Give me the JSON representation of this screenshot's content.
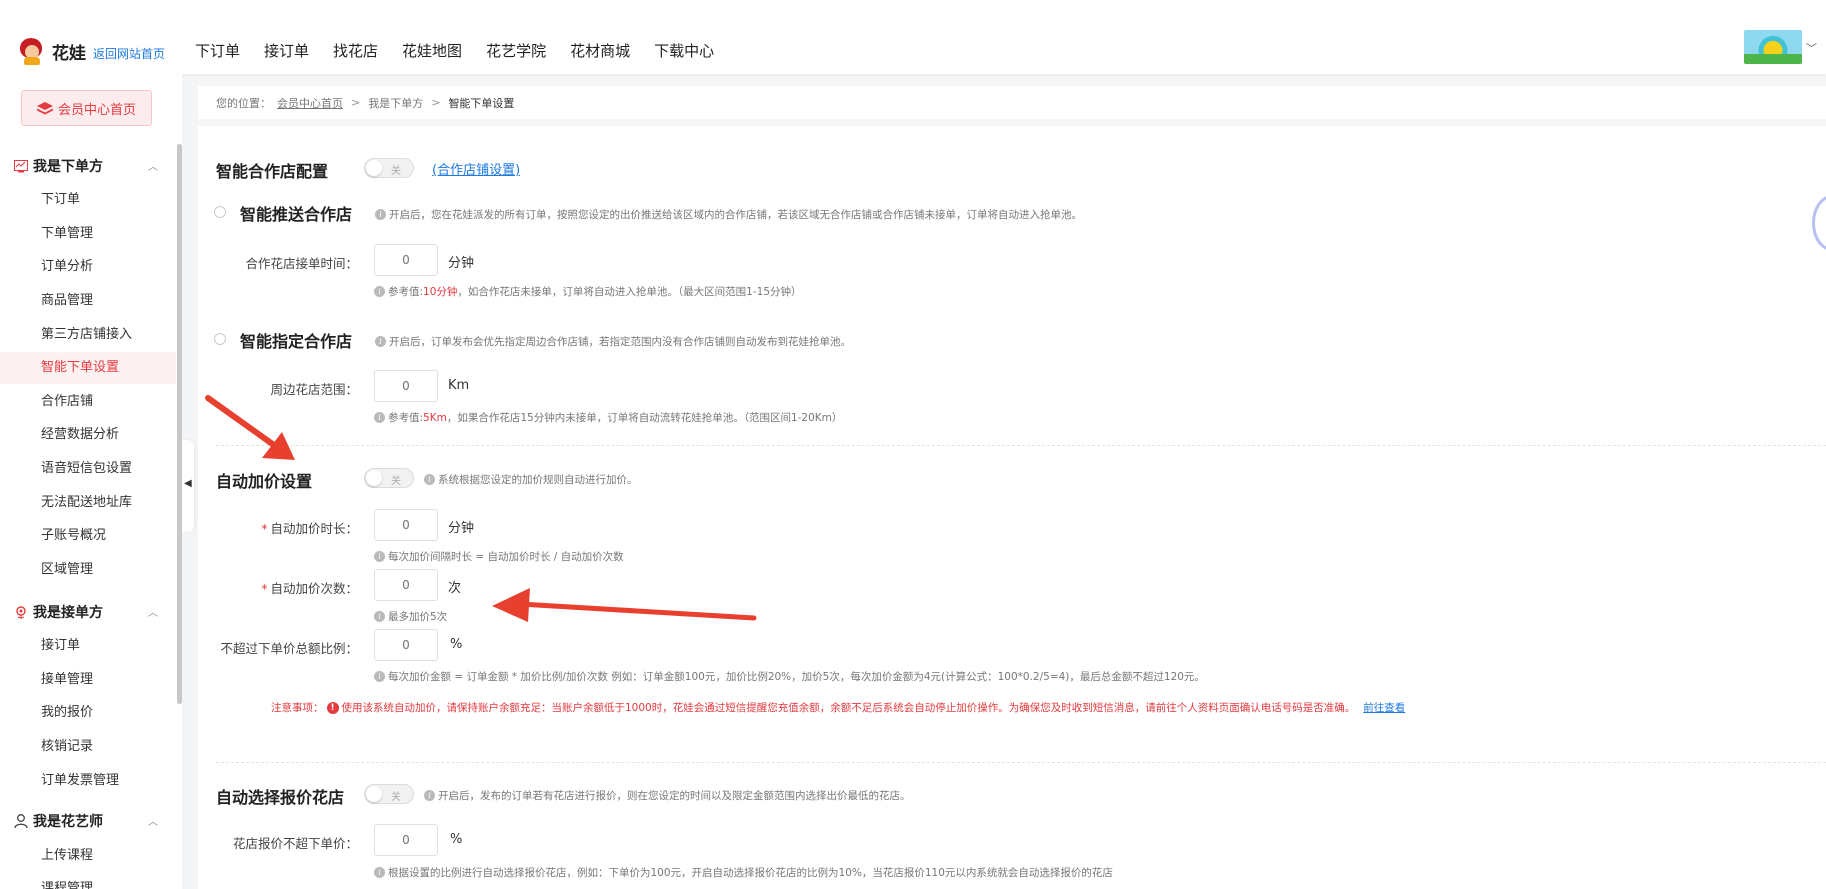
{
  "header": {
    "logo_text": "花娃",
    "back_home": "返回网站首页",
    "nav": [
      "下订单",
      "接订单",
      "找花店",
      "花娃地图",
      "花艺学院",
      "花材商城",
      "下载中心"
    ]
  },
  "sidebar": {
    "member_home": "会员中心首页",
    "groups": [
      {
        "title": "我是下单方",
        "items": [
          "下订单",
          "下单管理",
          "订单分析",
          "商品管理",
          "第三方店铺接入",
          "智能下单设置",
          "合作店铺",
          "经营数据分析",
          "语音短信包设置",
          "无法配送地址库",
          "子账号概况",
          "区域管理"
        ]
      },
      {
        "title": "我是接单方",
        "items": [
          "接订单",
          "接单管理",
          "我的报价",
          "核销记录",
          "订单发票管理"
        ]
      },
      {
        "title": "我是花艺师",
        "items": [
          "上传课程",
          "课程管理"
        ]
      }
    ],
    "active_item": "智能下单设置"
  },
  "breadcrumb": {
    "prefix": "您的位置：",
    "home": "会员中心首页",
    "level2": "我是下单方",
    "current": "智能下单设置"
  },
  "sections": {
    "coop": {
      "title": "智能合作店配置",
      "toggle_label": "关",
      "link": "(合作店铺设置)",
      "push": {
        "title": "智能推送合作店",
        "desc": "开启后，您在花娃派发的所有订单，按照您设定的出价推送给该区域内的合作店铺，若该区域无合作店铺或合作店铺未接单，订单将自动进入抢单池。",
        "field_label": "合作花店接单时间：",
        "placeholder": "0",
        "unit": "分钟",
        "hint_prefix": "参考值: ",
        "hint_value": "10分钟",
        "hint_suffix": "，如合作花店未接单，订单将自动进入抢单池。（最大区间范围1-15分钟）"
      },
      "assign": {
        "title": "智能指定合作店",
        "desc": "开启后，订单发布会优先指定周边合作店铺，若指定范围内没有合作店铺则自动发布到花娃抢单池。",
        "field_label": "周边花店范围：",
        "placeholder": "0",
        "unit": "Km",
        "hint_prefix": "参考值: ",
        "hint_value": "5Km",
        "hint_suffix": "，如果合作花店15分钟内未接单，订单将自动流转花娃抢单池。（范围区间1-20Km）"
      }
    },
    "auto_price": {
      "title": "自动加价设置",
      "toggle_label": "关",
      "desc": "系统根据您设定的加价规则自动进行加价。",
      "duration_label": "自动加价时长：",
      "duration_placeholder": "0",
      "duration_unit": "分钟",
      "duration_hint": "每次加价间隔时长 = 自动加价时长 / 自动加价次数",
      "count_label": "自动加价次数：",
      "count_placeholder": "0",
      "count_unit": "次",
      "count_hint": "最多加价5次",
      "ratio_label": "不超过下单价总额比例：",
      "ratio_placeholder": "0",
      "ratio_unit": "%",
      "ratio_hint": "每次加价金额 = 订单金额 * 加价比例/加价次数 例如：订单金额100元，加价比例20%，加价5次，每次加价金额为4元(计算公式：100*0.2/5=4)，最后总金额不超过120元。",
      "notice_label": "注意事项：",
      "notice_text": "使用该系统自动加价，请保持账户余额充足：当账户余额低于1000时，花娃会通过短信提醒您充值余额，余额不足后系统会自动停止加价操作。为确保您及时收到短信消息，请前往个人资料页面确认电话号码是否准确。",
      "notice_link": "前往查看"
    },
    "auto_select": {
      "title": "自动选择报价花店",
      "toggle_label": "关",
      "desc": "开启后，发布的订单若有花店进行报价，则在您设定的时间以及限定金额范围内选择出价最低的花店。",
      "field_label": "花店报价不超下单价：",
      "placeholder": "0",
      "unit": "%",
      "hint": "根据设置的比例进行自动选择报价花店，例如：下单价为100元，开启自动选择报价花店的比例为10%，当花店报价110元以内系统就会自动选择报价的花店"
    }
  },
  "colors": {
    "accent": "#e33b3f",
    "link": "#1f7ae0",
    "annotation": "#e8402f"
  }
}
